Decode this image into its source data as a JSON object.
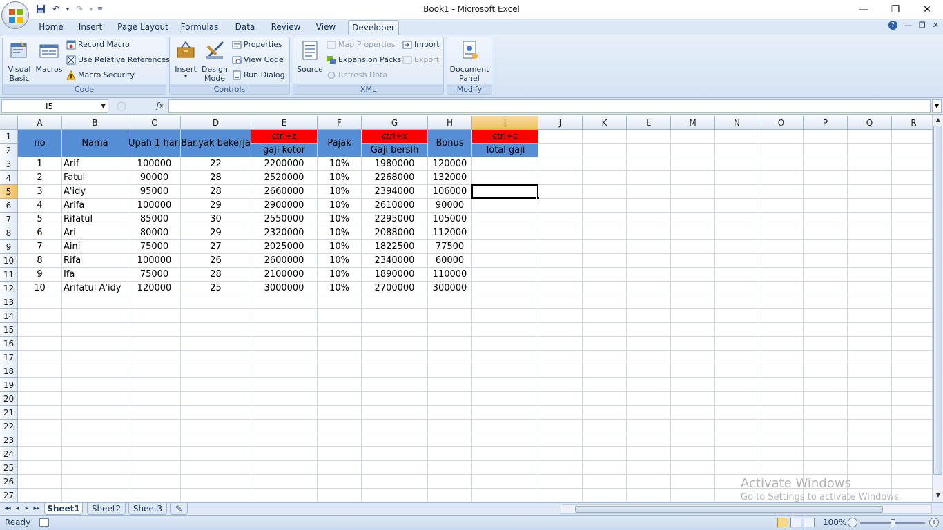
{
  "window": {
    "title": "Book1 - Microsoft Excel",
    "controls": {
      "minimize": "—",
      "restore": "❐",
      "close": "✕"
    }
  },
  "ribbon": {
    "tabs": [
      "Home",
      "Insert",
      "Page Layout",
      "Formulas",
      "Data",
      "Review",
      "View",
      "Developer"
    ],
    "active_tab": "Developer",
    "groups": {
      "code": {
        "label": "Code",
        "visual_basic": "Visual Basic",
        "macros": "Macros",
        "record_macro": "Record Macro",
        "use_relative": "Use Relative References",
        "macro_security": "Macro Security"
      },
      "controls": {
        "label": "Controls",
        "insert": "Insert",
        "design_mode": "Design Mode",
        "properties": "Properties",
        "view_code": "View Code",
        "run_dialog": "Run Dialog"
      },
      "xml": {
        "label": "XML",
        "source": "Source",
        "map_properties": "Map Properties",
        "expansion_packs": "Expansion Packs",
        "refresh_data": "Refresh Data",
        "import": "Import",
        "export": "Export"
      },
      "modify": {
        "label": "Modify",
        "document_panel": "Document Panel"
      }
    }
  },
  "formula_bar": {
    "name_box": "I5",
    "fx": "fx",
    "formula": ""
  },
  "columns": [
    "A",
    "B",
    "C",
    "D",
    "E",
    "F",
    "G",
    "H",
    "I",
    "J",
    "K",
    "L",
    "M",
    "N",
    "O",
    "P",
    "Q",
    "R"
  ],
  "selected_column": "I",
  "selected_row": 5,
  "rows": [
    "1",
    "2",
    "3",
    "4",
    "5",
    "6",
    "7",
    "8",
    "9",
    "10",
    "11",
    "12",
    "13",
    "14",
    "15",
    "16",
    "17",
    "18",
    "19",
    "20",
    "21",
    "22",
    "23",
    "24",
    "25",
    "26",
    "27"
  ],
  "sheet": {
    "header": {
      "no": "no",
      "nama": "Nama",
      "upah": "Upah 1 hari",
      "banyak": "Banyak bekerja",
      "ctrl_z": "ctrl+z",
      "gaji_kotor": "gaji kotor",
      "pajak": "Pajak",
      "ctrl_x": "ctrl+x",
      "gaji_bersih": "Gaji bersih",
      "bonus": "Bonus",
      "ctrl_c": "ctrl+c",
      "total_gaji": "Total gaji"
    },
    "data": [
      [
        "1",
        "Arif",
        "100000",
        "22",
        "2200000",
        "10%",
        "1980000",
        "120000"
      ],
      [
        "2",
        "Fatul",
        "90000",
        "28",
        "2520000",
        "10%",
        "2268000",
        "132000"
      ],
      [
        "3",
        "A'idy",
        "95000",
        "28",
        "2660000",
        "10%",
        "2394000",
        "106000"
      ],
      [
        "4",
        "Arifa",
        "100000",
        "29",
        "2900000",
        "10%",
        "2610000",
        "90000"
      ],
      [
        "5",
        "Rifatul",
        "85000",
        "30",
        "2550000",
        "10%",
        "2295000",
        "105000"
      ],
      [
        "6",
        "Ari",
        "80000",
        "29",
        "2320000",
        "10%",
        "2088000",
        "112000"
      ],
      [
        "7",
        "Aini",
        "75000",
        "27",
        "2025000",
        "10%",
        "1822500",
        "77500"
      ],
      [
        "8",
        "Rifa",
        "100000",
        "26",
        "2600000",
        "10%",
        "2340000",
        "60000"
      ],
      [
        "9",
        "Ifa",
        "75000",
        "28",
        "2100000",
        "10%",
        "1890000",
        "110000"
      ],
      [
        "10",
        "Arifatul A'idy",
        "120000",
        "25",
        "3000000",
        "10%",
        "2700000",
        "300000"
      ]
    ]
  },
  "sheet_tabs": [
    "Sheet1",
    "Sheet2",
    "Sheet3"
  ],
  "active_sheet": "Sheet1",
  "status": {
    "ready": "Ready",
    "zoom": "100%"
  },
  "watermark": {
    "line1": "Activate Windows",
    "line2": "Go to Settings to activate Windows."
  },
  "colors": {
    "header_blue": "#558ed5",
    "header_red": "#ff0000",
    "selection_header": "#f1c15f"
  }
}
